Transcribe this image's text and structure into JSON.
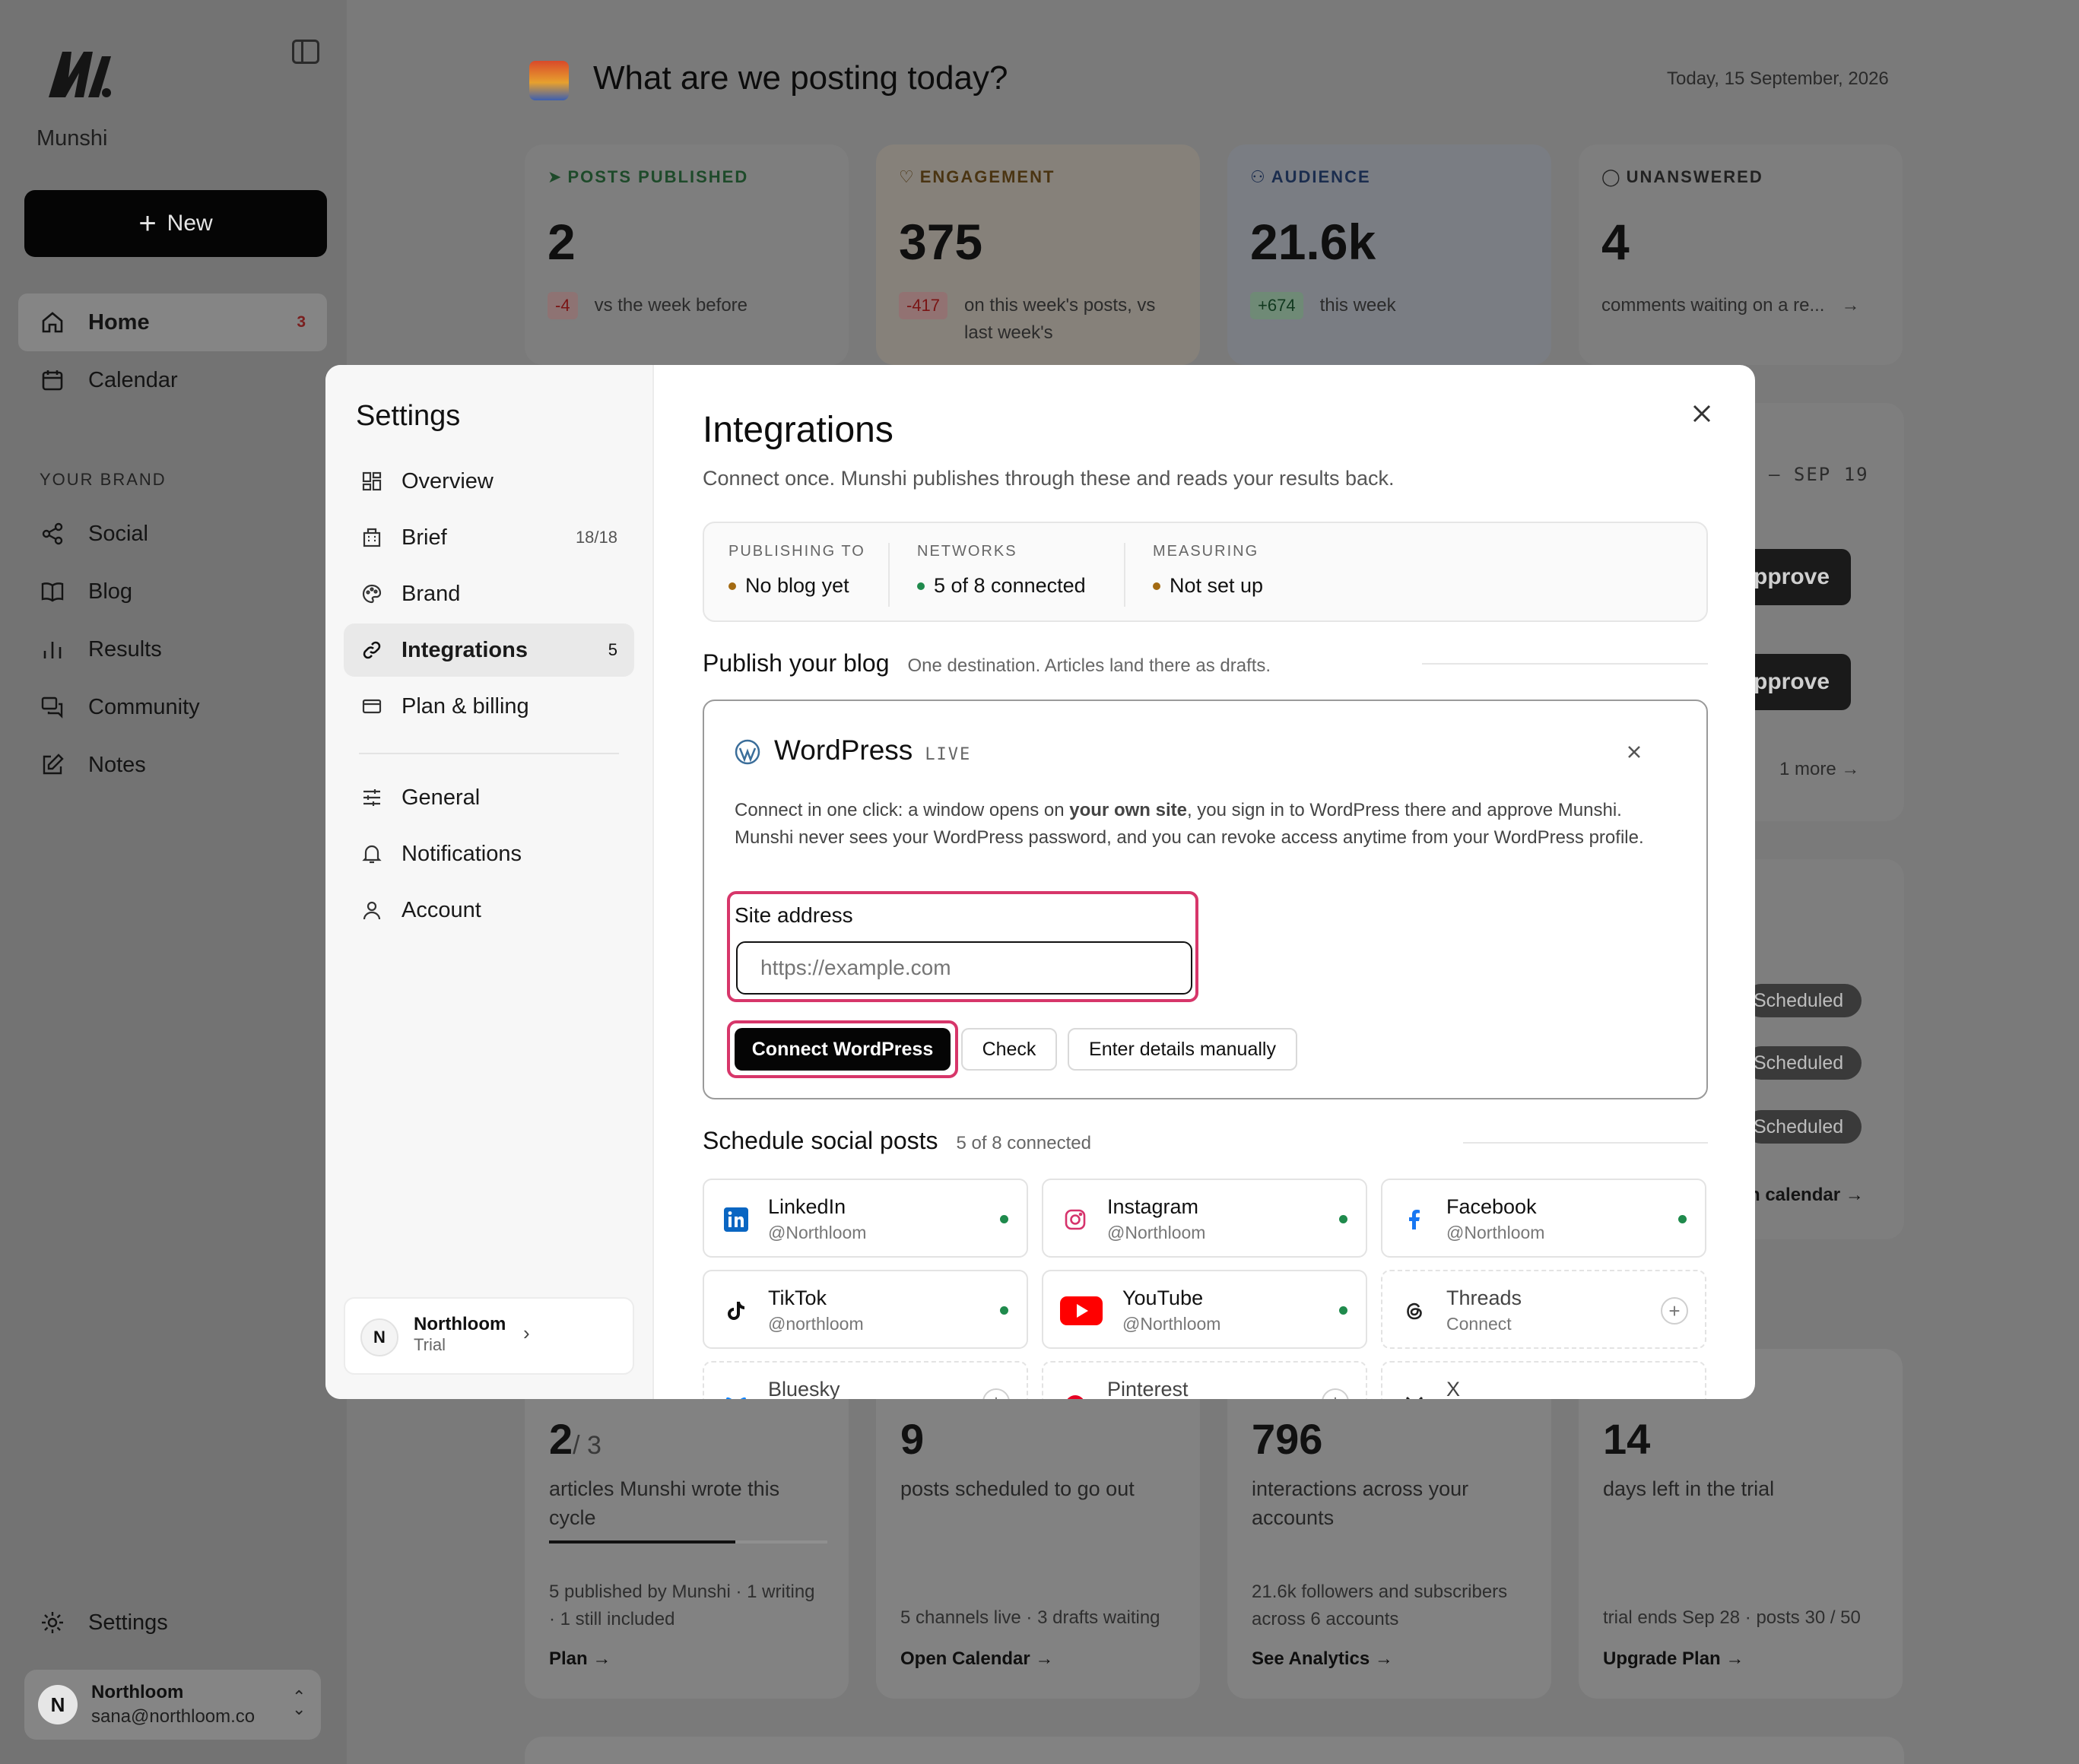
{
  "app": {
    "brand": "Munshi",
    "new_label": "New"
  },
  "sidebar": {
    "items": [
      {
        "label": "Home",
        "badge": "3"
      },
      {
        "label": "Calendar"
      }
    ],
    "section": "YOUR BRAND",
    "brand_items": [
      {
        "label": "Social"
      },
      {
        "label": "Blog"
      },
      {
        "label": "Results"
      },
      {
        "label": "Community"
      },
      {
        "label": "Notes"
      }
    ],
    "settings_label": "Settings",
    "user": {
      "initial": "N",
      "name": "Northloom",
      "email": "sana@northloom.co"
    }
  },
  "main": {
    "title": "What are we posting today?",
    "date": "Today, 15 September, 2026",
    "stats": [
      {
        "label": "POSTS PUBLISHED",
        "value": "2",
        "delta": "-4",
        "note": "vs the week before"
      },
      {
        "label": "ENGAGEMENT",
        "value": "375",
        "delta": "-417",
        "note": "on this week's posts, vs last week's"
      },
      {
        "label": "AUDIENCE",
        "value": "21.6k",
        "delta": "+674",
        "note": "this week"
      },
      {
        "label": "UNANSWERED",
        "value": "4",
        "note": "comments waiting on a re..."
      }
    ],
    "side_range": "– SEP 19",
    "approve_label": "pprove",
    "more_label": "1 more",
    "scheduled_label": "Scheduled",
    "calendar_link": "n calendar →",
    "cards": [
      {
        "value": "2",
        "value_suffix": "/ 3",
        "desc": "articles Munshi wrote this cycle",
        "progress": 0.67,
        "foot": "5 published by Munshi · 1 writing · 1 still included",
        "link": "Plan →"
      },
      {
        "value": "9",
        "desc": "posts scheduled to go out",
        "foot": "5 channels live · 3 drafts waiting",
        "link": "Open Calendar →"
      },
      {
        "value": "796",
        "desc": "interactions across your accounts",
        "foot": "21.6k followers and subscribers across 6 accounts",
        "link": "See Analytics →"
      },
      {
        "value": "14",
        "desc": "days left in the trial",
        "foot": "trial ends Sep 28 · posts 30 / 50",
        "link": "Upgrade Plan →"
      }
    ]
  },
  "settings": {
    "title": "Settings",
    "nav": [
      {
        "label": "Overview"
      },
      {
        "label": "Brief",
        "count": "18/18"
      },
      {
        "label": "Brand"
      },
      {
        "label": "Integrations",
        "count": "5"
      },
      {
        "label": "Plan & billing"
      }
    ],
    "nav2": [
      {
        "label": "General"
      },
      {
        "label": "Notifications"
      },
      {
        "label": "Account"
      }
    ],
    "org": {
      "initial": "N",
      "name": "Northloom",
      "plan": "Trial"
    }
  },
  "integrations": {
    "title": "Integrations",
    "lead": "Connect once. Munshi publishes through these and reads your results back.",
    "summary": [
      {
        "key": "PUBLISHING TO",
        "value": "No blog yet",
        "color": "#a36a12"
      },
      {
        "key": "NETWORKS",
        "value": "5 of 8 connected",
        "color": "#1f8a4c"
      },
      {
        "key": "MEASURING",
        "value": "Not set up",
        "color": "#a36a12"
      }
    ],
    "blog": {
      "heading": "Publish your blog",
      "sub": "One destination. Articles land there as drafts.",
      "provider": "WordPress",
      "status": "LIVE",
      "desc_1": "Connect in one click: a window opens on ",
      "desc_bold": "your own site",
      "desc_2": ", you sign in to WordPress there and approve Munshi. Munshi never sees your WordPress password, and you can revoke access anytime from your WordPress profile.",
      "site_label": "Site address",
      "site_placeholder": "https://example.com",
      "connect_label": "Connect WordPress",
      "check_label": "Check",
      "manual_label": "Enter details manually"
    },
    "social": {
      "heading": "Schedule social posts",
      "sub": "5 of 8 connected",
      "networks": [
        {
          "name": "LinkedIn",
          "handle": "@Northloom",
          "connected": true
        },
        {
          "name": "Instagram",
          "handle": "@Northloom",
          "connected": true
        },
        {
          "name": "Facebook",
          "handle": "@Northloom",
          "connected": true
        },
        {
          "name": "TikTok",
          "handle": "@northloom",
          "connected": true
        },
        {
          "name": "YouTube",
          "handle": "@Northloom",
          "connected": true
        },
        {
          "name": "Threads",
          "handle": "Connect",
          "connected": false
        },
        {
          "name": "Bluesky",
          "handle": "",
          "connected": false
        },
        {
          "name": "Pinterest",
          "handle": "",
          "connected": false
        },
        {
          "name": "X",
          "handle": "",
          "connected": false
        }
      ]
    }
  },
  "colors": {
    "accent_highlight": "#d7366a",
    "connected": "#1f8a4c",
    "pending": "#a36a12"
  }
}
